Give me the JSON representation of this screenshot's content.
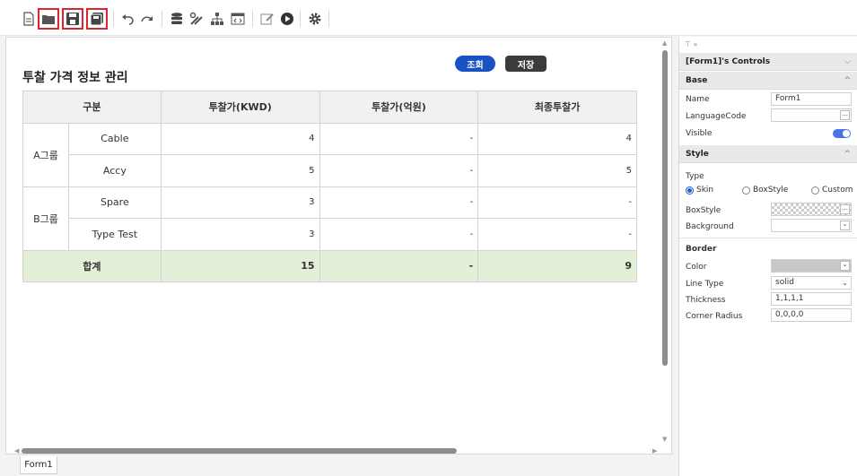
{
  "toolbar": {
    "items": [
      "new-file-icon",
      "open-folder-icon",
      "save-icon",
      "save-all-icon",
      "undo-icon",
      "redo-icon",
      "database-icon",
      "tools-icon",
      "hierarchy-icon",
      "code-view-icon",
      "edit-icon",
      "run-icon",
      "settings-icon"
    ],
    "highlight_color": "#e0242f"
  },
  "page": {
    "title": "투찰 가격 정보 관리",
    "search_button": "조회",
    "save_button": "저장"
  },
  "grid": {
    "headers": [
      "구분",
      "투찰가(KWD)",
      "투찰가(억원)",
      "최종투찰가"
    ],
    "groups": [
      {
        "name": "A그룹",
        "rows": [
          {
            "item": "Cable",
            "kwd": "4",
            "eok": "-",
            "final": "4"
          },
          {
            "item": "Accy",
            "kwd": "5",
            "eok": "-",
            "final": "5"
          }
        ]
      },
      {
        "name": "B그룹",
        "rows": [
          {
            "item": "Spare",
            "kwd": "3",
            "eok": "-",
            "final": "-"
          },
          {
            "item": "Type Test",
            "kwd": "3",
            "eok": "-",
            "final": "-"
          }
        ]
      }
    ],
    "total": {
      "label": "합계",
      "kwd": "15",
      "eok": "-",
      "final": "9"
    },
    "total_bg": "#e3efd9"
  },
  "tabs": {
    "form": "Form1"
  },
  "panel": {
    "pin": "⊤ »",
    "header": "[Form1]'s Controls",
    "base": {
      "title": "Base",
      "name_label": "Name",
      "name_value": "Form1",
      "language_label": "LanguageCode",
      "language_value": "",
      "visible_label": "Visible"
    },
    "style": {
      "title": "Style",
      "type_label": "Type",
      "type_options": [
        "Skin",
        "BoxStyle",
        "Custom"
      ],
      "type_selected": "Skin",
      "boxstyle_label": "BoxStyle",
      "background_label": "Background"
    },
    "border": {
      "title": "Border",
      "color_label": "Color",
      "linetype_label": "Line Type",
      "linetype_value": "solid",
      "thickness_label": "Thickness",
      "thickness_value": "1,1,1,1",
      "radius_label": "Corner Radius",
      "radius_value": "0,0,0,0"
    }
  },
  "colors": {
    "accent": "#1a52c4",
    "toggle": "#4d71e8"
  }
}
